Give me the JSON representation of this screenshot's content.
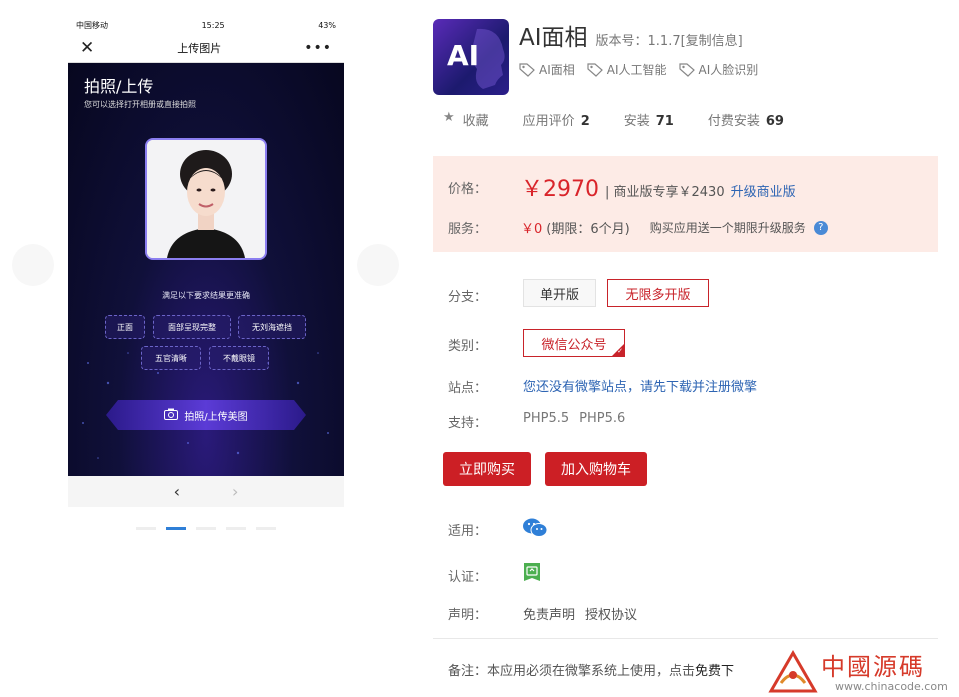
{
  "phone": {
    "status_carrier": "中国移动",
    "status_time": "15:25",
    "status_battery": "43%",
    "nav_title": "上传图片",
    "nav_close": "✕",
    "nav_more": "•••",
    "heading": "拍照/上传",
    "subheading": "您可以选择打开相册或直接拍照",
    "hint": "满足以下要求结果更准确",
    "requirements": [
      "正面",
      "面部呈现完整",
      "无刘海遮挡",
      "五官清晰",
      "不戴眼镜"
    ],
    "cta_label": "拍照/上传美图",
    "back": "‹",
    "forward": "›"
  },
  "app": {
    "icon_text": "AI",
    "name": "AI面相",
    "version": "版本号：1.1.7[复制信息]",
    "tags": [
      "AI面相",
      "AI人工智能",
      "AI人脸识别"
    ]
  },
  "stats": {
    "favorite": "收藏",
    "rating_label": "应用评价",
    "rating_value": "2",
    "install_label": "安装",
    "install_value": "71",
    "paid_label": "付费安装",
    "paid_value": "69"
  },
  "price": {
    "label": "价格：",
    "amount": "￥2970",
    "business": "| 商业版专享￥2430",
    "upgrade": "升级商业版",
    "service_label": "服务：",
    "service_amount": "￥0",
    "service_period": "(期限：6个月)",
    "service_gift": "购买应用送一个期限升级服务",
    "help": "?"
  },
  "options": {
    "branch_label": "分支：",
    "branch_single": "单开版",
    "branch_multi": "无限多开版",
    "type_label": "类别：",
    "type_value": "微信公众号",
    "site_label": "站点：",
    "site_link": "您还没有微擎站点，请先下载并注册微擎",
    "support_label": "支持：",
    "support": [
      "PHP5.5",
      "PHP5.6"
    ]
  },
  "actions": {
    "buy": "立即购买",
    "cart": "加入购物车"
  },
  "meta": {
    "apply_label": "适用：",
    "cert_label": "认证：",
    "declare_label": "声明：",
    "disclaimer": "免责声明",
    "license": "授权协议",
    "note": "备注：本应用必须在微擎系统上使用，点击",
    "note_link": "免费下"
  },
  "watermark": {
    "title": "中國源碼",
    "url": "www.chinacode.com"
  },
  "colors": {
    "accent_red": "#cc1f25",
    "link_blue": "#2d64b3",
    "price_bg": "#fdebe6"
  },
  "carousel": {
    "slides": 5,
    "active_index": 1
  }
}
